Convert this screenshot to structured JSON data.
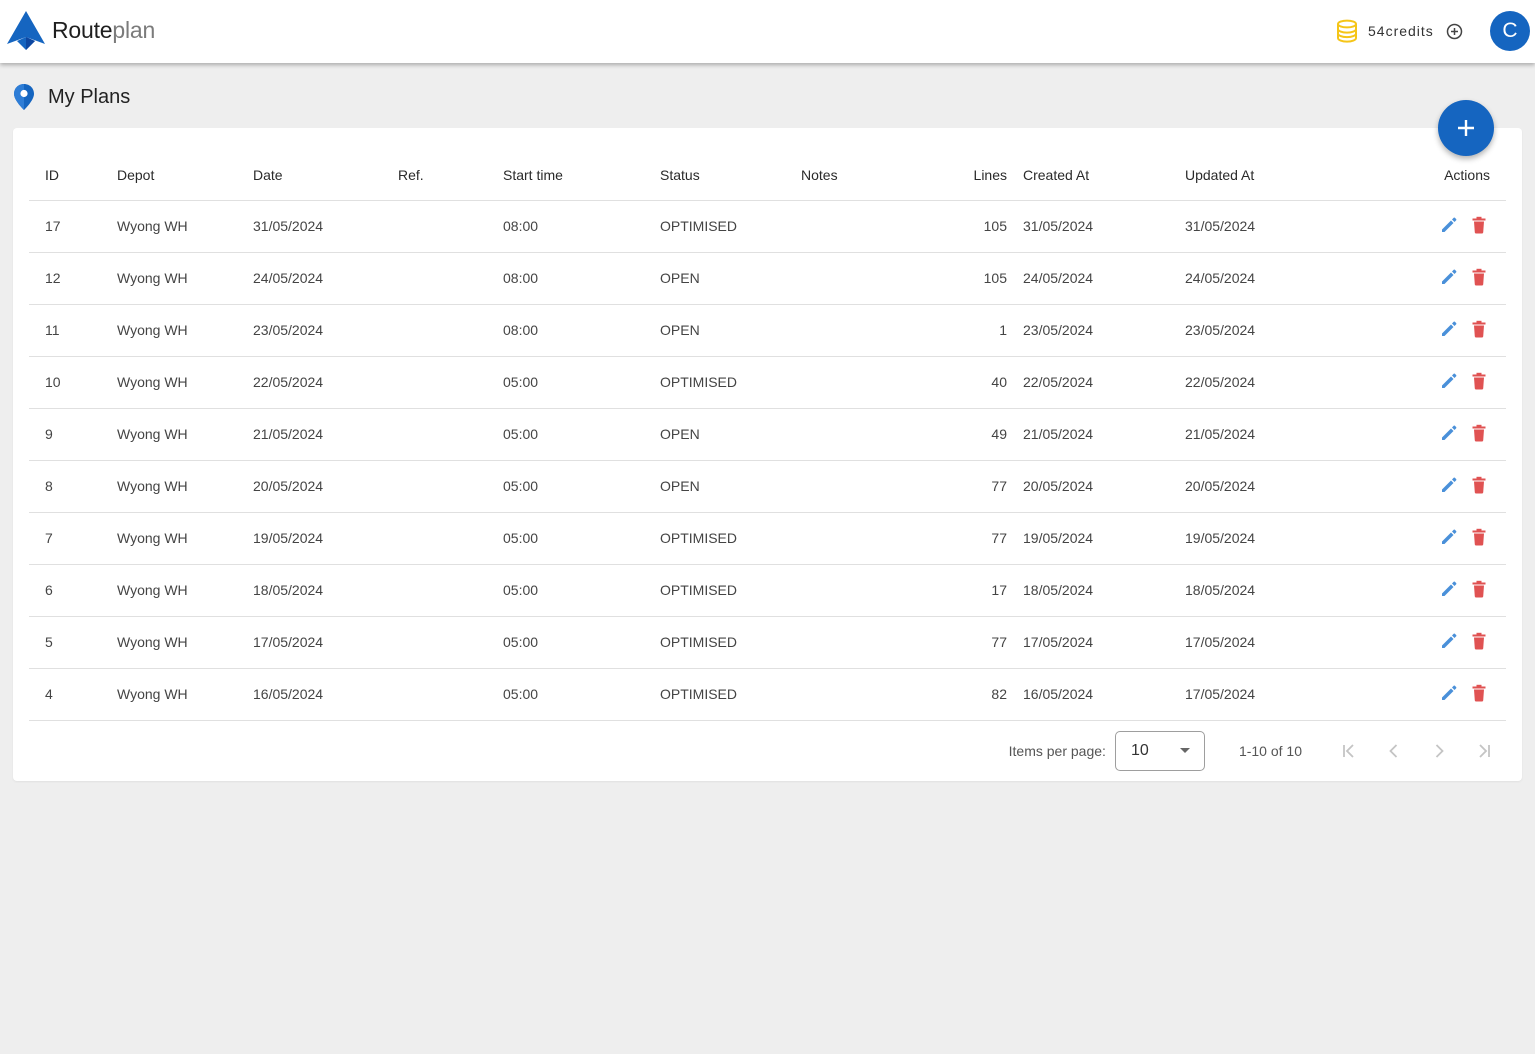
{
  "app": {
    "name_part1": "Route",
    "name_part2": "plan"
  },
  "colors": {
    "primary": "#1565c0",
    "edit": "#4a90d9",
    "delete": "#e05252",
    "coin": "#f5c518"
  },
  "header": {
    "credits": "54credits",
    "avatar_letter": "C"
  },
  "page": {
    "title": "My Plans",
    "icon": "map-pin-icon"
  },
  "table": {
    "columns": [
      "ID",
      "Depot",
      "Date",
      "Ref.",
      "Start time",
      "Status",
      "Notes",
      "Lines",
      "Created At",
      "Updated At",
      "Actions"
    ],
    "rows": [
      {
        "id": "17",
        "depot": "Wyong WH",
        "date": "31/05/2024",
        "ref": "",
        "start": "08:00",
        "status": "OPTIMISED",
        "notes": "",
        "lines": "105",
        "created": "31/05/2024",
        "updated": "31/05/2024"
      },
      {
        "id": "12",
        "depot": "Wyong WH",
        "date": "24/05/2024",
        "ref": "",
        "start": "08:00",
        "status": "OPEN",
        "notes": "",
        "lines": "105",
        "created": "24/05/2024",
        "updated": "24/05/2024"
      },
      {
        "id": "11",
        "depot": "Wyong WH",
        "date": "23/05/2024",
        "ref": "",
        "start": "08:00",
        "status": "OPEN",
        "notes": "",
        "lines": "1",
        "created": "23/05/2024",
        "updated": "23/05/2024"
      },
      {
        "id": "10",
        "depot": "Wyong WH",
        "date": "22/05/2024",
        "ref": "",
        "start": "05:00",
        "status": "OPTIMISED",
        "notes": "",
        "lines": "40",
        "created": "22/05/2024",
        "updated": "22/05/2024"
      },
      {
        "id": "9",
        "depot": "Wyong WH",
        "date": "21/05/2024",
        "ref": "",
        "start": "05:00",
        "status": "OPEN",
        "notes": "",
        "lines": "49",
        "created": "21/05/2024",
        "updated": "21/05/2024"
      },
      {
        "id": "8",
        "depot": "Wyong WH",
        "date": "20/05/2024",
        "ref": "",
        "start": "05:00",
        "status": "OPEN",
        "notes": "",
        "lines": "77",
        "created": "20/05/2024",
        "updated": "20/05/2024"
      },
      {
        "id": "7",
        "depot": "Wyong WH",
        "date": "19/05/2024",
        "ref": "",
        "start": "05:00",
        "status": "OPTIMISED",
        "notes": "",
        "lines": "77",
        "created": "19/05/2024",
        "updated": "19/05/2024"
      },
      {
        "id": "6",
        "depot": "Wyong WH",
        "date": "18/05/2024",
        "ref": "",
        "start": "05:00",
        "status": "OPTIMISED",
        "notes": "",
        "lines": "17",
        "created": "18/05/2024",
        "updated": "18/05/2024"
      },
      {
        "id": "5",
        "depot": "Wyong WH",
        "date": "17/05/2024",
        "ref": "",
        "start": "05:00",
        "status": "OPTIMISED",
        "notes": "",
        "lines": "77",
        "created": "17/05/2024",
        "updated": "17/05/2024"
      },
      {
        "id": "4",
        "depot": "Wyong WH",
        "date": "16/05/2024",
        "ref": "",
        "start": "05:00",
        "status": "OPTIMISED",
        "notes": "",
        "lines": "82",
        "created": "16/05/2024",
        "updated": "17/05/2024"
      }
    ]
  },
  "paginator": {
    "items_per_page_label": "Items per page:",
    "items_per_page_value": "10",
    "range_label": "1-10 of 10"
  }
}
